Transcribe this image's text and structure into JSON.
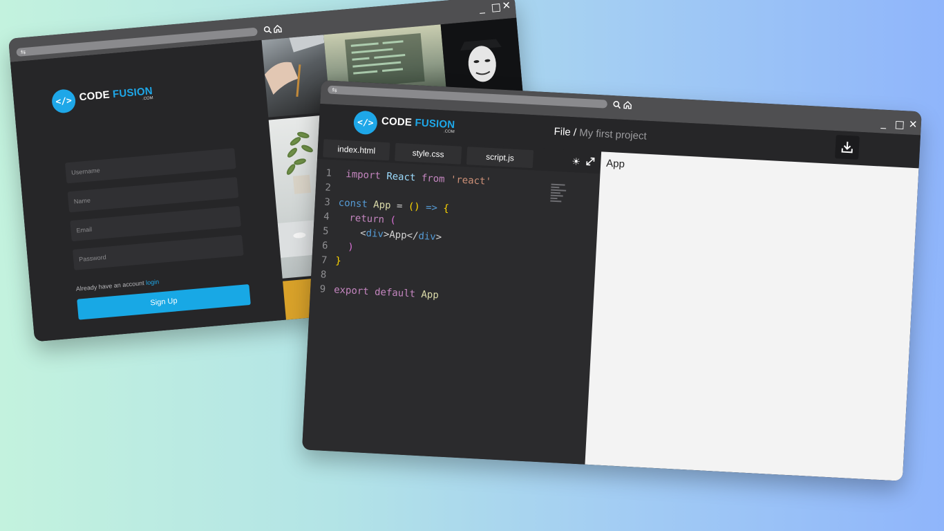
{
  "colors": {
    "accent": "#1ea7e8",
    "window_dark": "#262628",
    "titlebar": "#4f4f51",
    "preview_bg": "#f3f3f3"
  },
  "back_window": {
    "icons": [
      "sliders-icon",
      "search-icon",
      "home-icon",
      "minimize-icon",
      "maximize-icon",
      "close-icon"
    ],
    "logo": {
      "mark": "</>",
      "word1": "CODE",
      "word2": "FUSION",
      "sub": ".COM"
    },
    "form": {
      "username_placeholder": "Username",
      "name_placeholder": "Name",
      "email_placeholder": "Email",
      "password_placeholder": "Password",
      "already_text": "Already have an account",
      "login_link": "login",
      "signup_button": "Sign Up"
    }
  },
  "front_window": {
    "icons": [
      "sliders-icon",
      "search-icon",
      "home-icon",
      "minimize-icon",
      "maximize-icon",
      "close-icon",
      "download-icon",
      "sun-icon",
      "expand-icon"
    ],
    "logo": {
      "mark": "</>",
      "word1": "CODE",
      "word2": "FUSION",
      "sub": ".COM"
    },
    "breadcrumb": {
      "root": "File",
      "separator": " / ",
      "project": "My first project"
    },
    "tabs": [
      "index.html",
      "style.css",
      "script.js"
    ],
    "code": {
      "line_numbers": [
        "1",
        "2",
        "3",
        "4",
        "5",
        "6",
        "7",
        "8",
        "9"
      ],
      "import_kw": "import",
      "react_id": "React",
      "from_kw": "from",
      "react_str": "'react'",
      "const_kw": "const",
      "app_id": "App",
      "equals": " = ",
      "parens": "()",
      "arrow": " => ",
      "open_brace": "{",
      "return_kw": "return",
      "open_paren": "(",
      "lt": "<",
      "div_tag": "div",
      "gt": ">",
      "jsx_text": "App",
      "close_lt": "</",
      "close_paren": ")",
      "close_brace": "}",
      "export_kw": "export",
      "default_kw": "default",
      "export_id": "App"
    },
    "preview_text": "App"
  }
}
